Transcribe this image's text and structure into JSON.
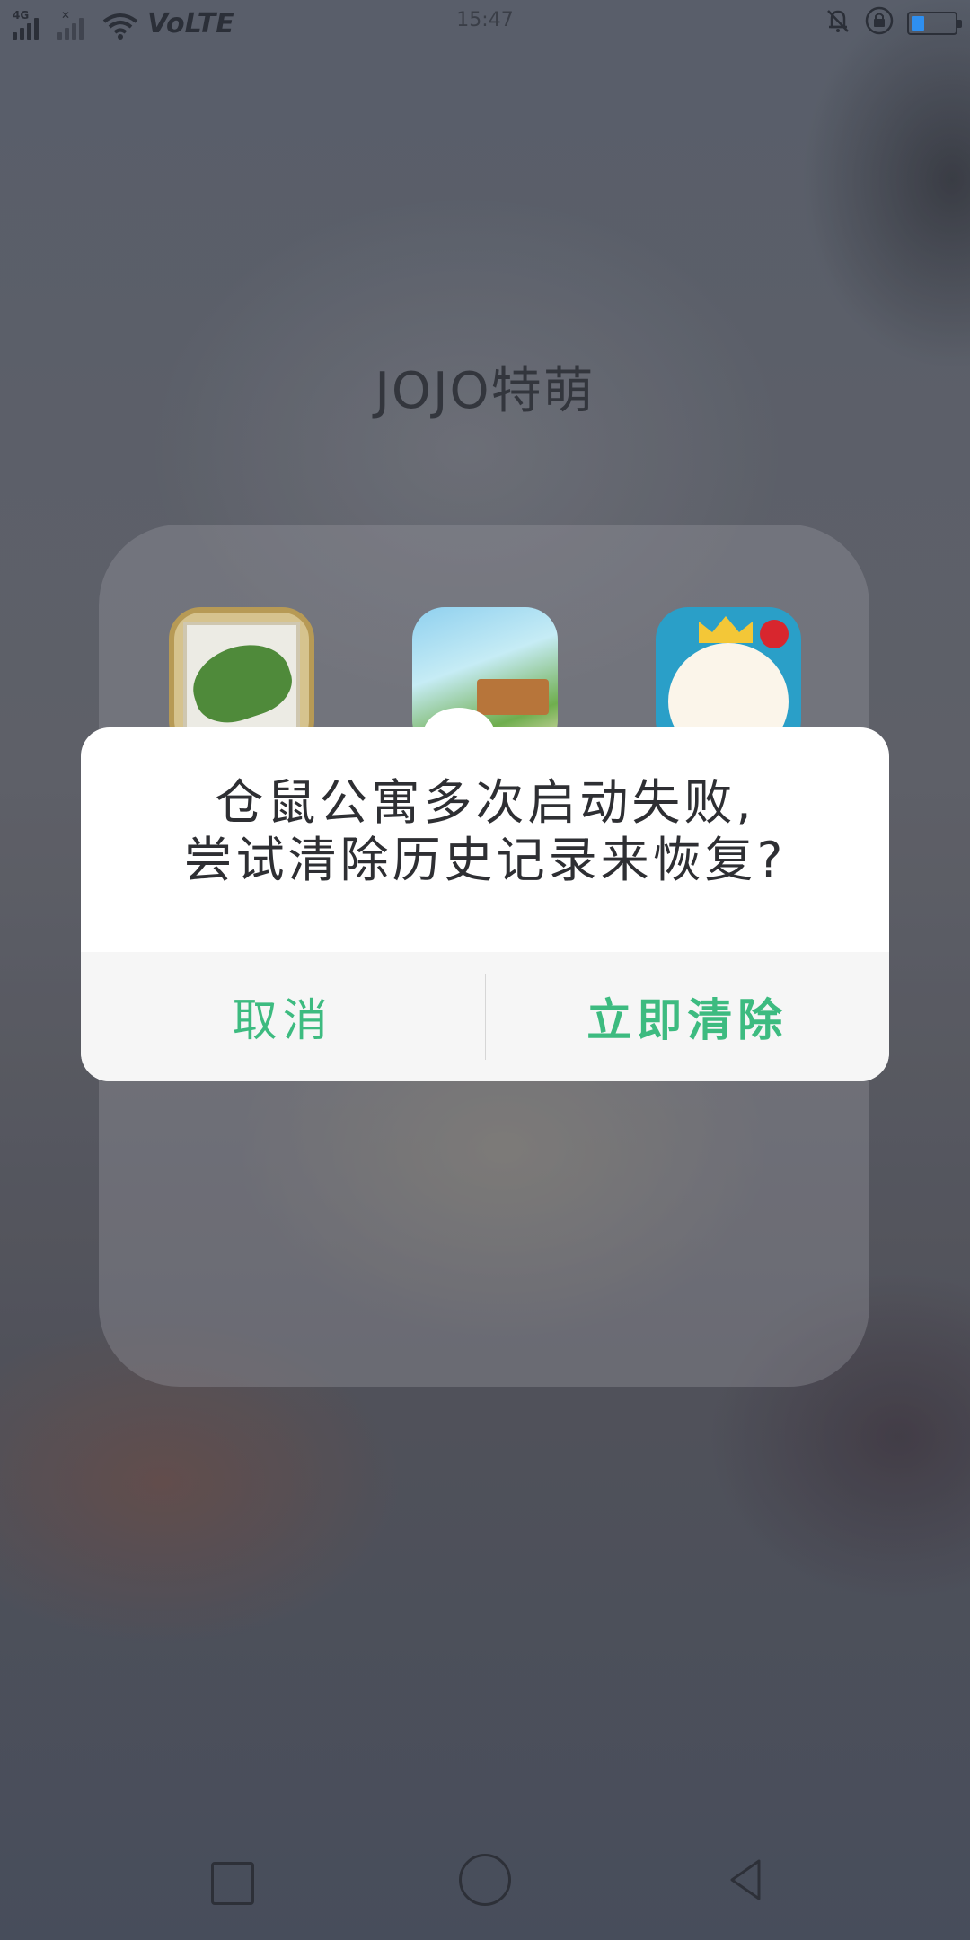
{
  "status_bar": {
    "network_type": "4G",
    "volte": "VoLTE",
    "time": "15:47",
    "battery_level": 0.3,
    "icons": [
      "signal-icon",
      "signal-x-icon",
      "wifi-icon",
      "mute-bell-icon",
      "rotation-lock-icon",
      "battery-icon"
    ]
  },
  "folder": {
    "title": "JOJO特萌",
    "apps": [
      {
        "name": "frog-travel-app-icon"
      },
      {
        "name": "cat-cafe-app-icon"
      },
      {
        "name": "hamster-apartment-app-icon"
      }
    ]
  },
  "dialog": {
    "message_line1": "仓鼠公寓多次启动失败,",
    "message_line2": "尝试清除历史记录来恢复?",
    "cancel_label": "取消",
    "confirm_label": "立即清除",
    "accent_color": "#3dbb80"
  },
  "nav_bar": {
    "buttons": [
      "recent-apps-button",
      "home-button",
      "back-button"
    ]
  }
}
